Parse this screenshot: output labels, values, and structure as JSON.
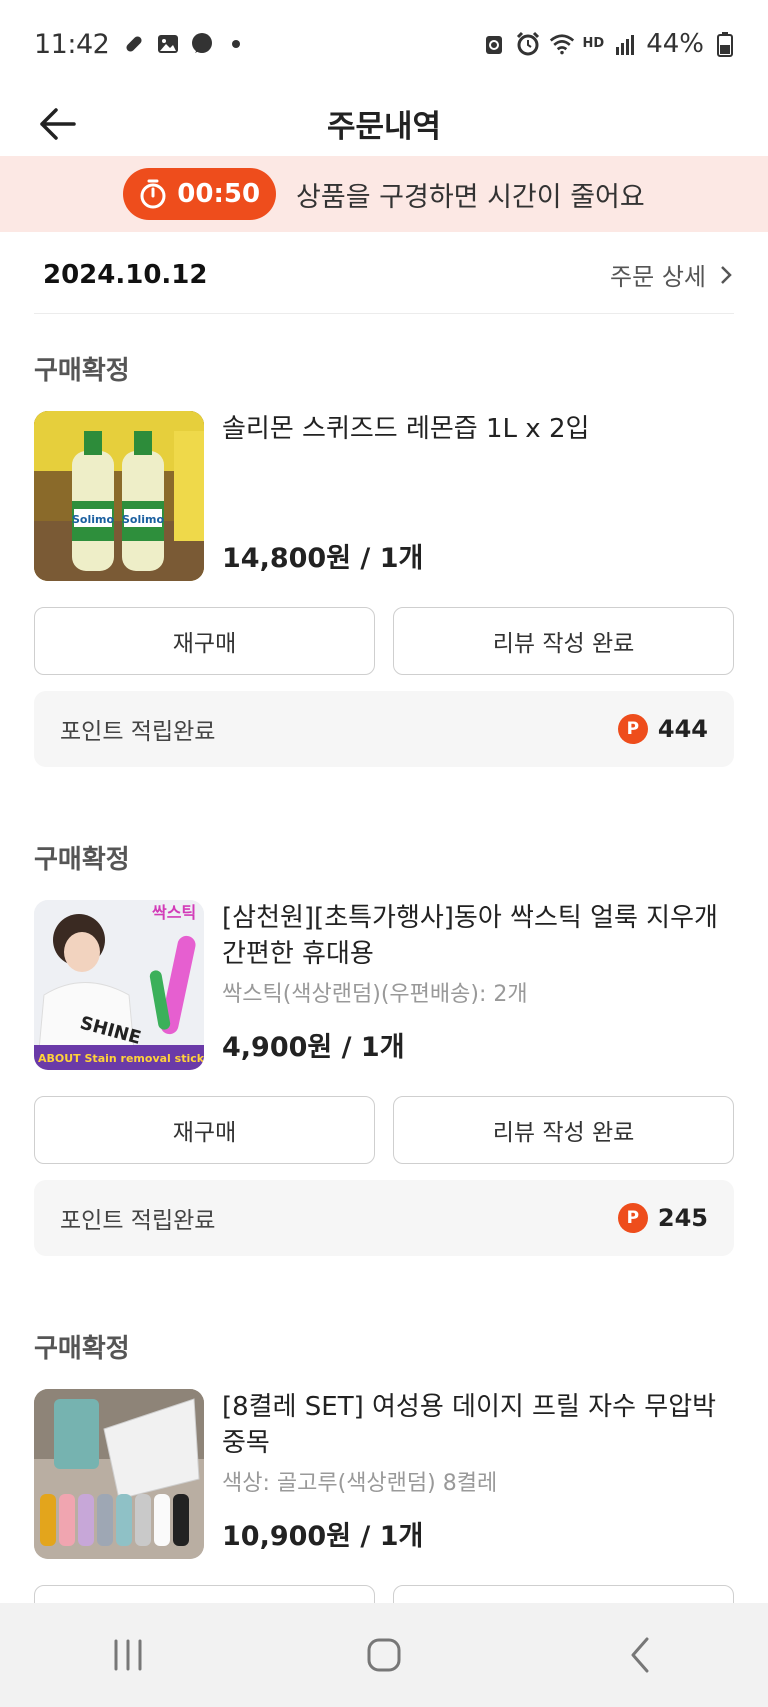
{
  "status_bar": {
    "time": "11:42",
    "battery": "44%",
    "voice_label": "HD"
  },
  "header": {
    "title": "주문내역"
  },
  "timer_banner": {
    "time": "00:50",
    "message": "상품을 구경하면 시간이 줄어요"
  },
  "order": {
    "date": "2024.10.12",
    "detail_link": "주문 상세",
    "items": [
      {
        "status": "구매확정",
        "name": "솔리몬 스퀴즈드 레몬즙 1L x 2입",
        "option": "",
        "price": "14,800원 / 1개",
        "rebuy_label": "재구매",
        "review_label": "리뷰 작성 완료",
        "point_label": "포인트 적립완료",
        "point_badge": "P",
        "points": "444",
        "thumb_text": "Solimo"
      },
      {
        "status": "구매확정",
        "name": "[삼천원][초특가행사]동아 싹스틱 얼룩 지우개 간편한 휴대용",
        "option": "싹스틱(색상랜덤)(우편배송): 2개",
        "price": "4,900원 / 1개",
        "rebuy_label": "재구매",
        "review_label": "리뷰 작성 완료",
        "point_label": "포인트 적립완료",
        "point_badge": "P",
        "points": "245",
        "thumb_text": "ABOUT Stain removal stick",
        "thumb_text2": "SHINE",
        "thumb_text3": "싹스틱"
      },
      {
        "status": "구매확정",
        "name": "[8켤레 SET] 여성용 데이지 프릴 자수 무압박 중목",
        "option": "색상: 골고루(색상랜덤) 8켤레",
        "price": "10,900원 / 1개"
      }
    ]
  }
}
